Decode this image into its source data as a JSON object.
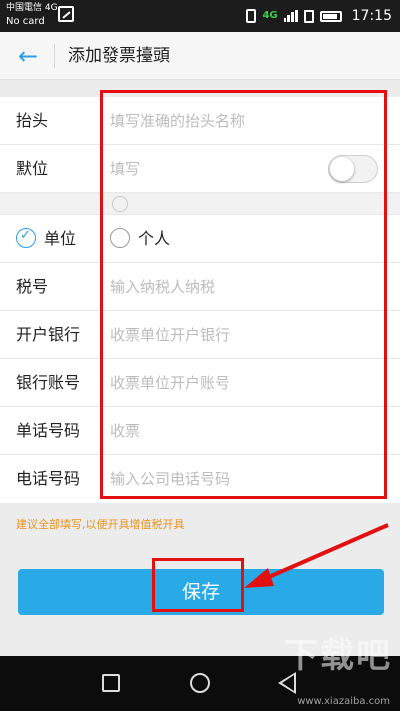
{
  "status_bar": {
    "carrier": "中国電信 4G",
    "sim_status": "No card",
    "network_badge": "4G",
    "time": "17:15",
    "icons": [
      "image-icon",
      "vibrate-icon",
      "signal-icon",
      "sim-icon",
      "battery-icon"
    ]
  },
  "header": {
    "back_icon": "arrow-left-icon",
    "title": "添加發票擡頭"
  },
  "form": {
    "title_field": {
      "label": "抬头",
      "placeholder": "填写准确的抬头名称"
    },
    "default_row": {
      "label": "默位",
      "placeholder": "填写"
    },
    "type_row": {
      "options": [
        "单位",
        "个人"
      ],
      "selected": "单位"
    },
    "tax_id": {
      "label": "税号",
      "placeholder": "输入纳税人纳税"
    },
    "bank": {
      "label": "开户银行",
      "placeholder": "收票单位开户银行"
    },
    "account": {
      "label": "银行账号",
      "placeholder": "收票单位开户账号"
    },
    "address": {
      "label": "单话号码",
      "placeholder": "收票"
    },
    "phone": {
      "label": "电话号码",
      "placeholder": "输入公司电话号码"
    }
  },
  "hint": "建议全部填写,以便开具增值税开具",
  "save_label": "保存",
  "watermark": {
    "big": "下载吧",
    "small": "www.xiazaiba.com"
  },
  "colors": {
    "accent": "#29a9e6",
    "annotation": "#e21010",
    "hint": "#e8931e"
  }
}
